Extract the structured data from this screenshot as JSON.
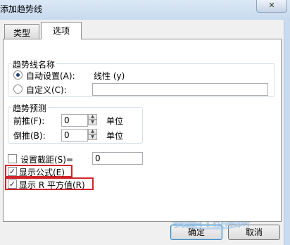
{
  "window": {
    "title": "添加趋势线",
    "close_label": "✕"
  },
  "tabs": [
    {
      "label": "类型"
    },
    {
      "label": "选项"
    }
  ],
  "name_group": {
    "legend": "趋势线名称",
    "auto_label": "自动设置(A):",
    "auto_value": "线性 (y)",
    "custom_label": "自定义(C):",
    "custom_value": ""
  },
  "forecast_group": {
    "legend": "趋势预测",
    "forward_label": "前推(F):",
    "forward_value": "0",
    "backward_label": "倒推(B):",
    "backward_value": "0",
    "unit": "单位"
  },
  "options": {
    "intercept_label": "设置截距(S)=",
    "intercept_value": "0",
    "intercept_checked": false,
    "show_equation_label": "显示公式(E)",
    "show_equation_checked": true,
    "show_r2_label": "显示 R 平方值(R)",
    "show_r2_checked": true,
    "check_glyph": "✓"
  },
  "buttons": {
    "ok": "确定",
    "cancel": "取消"
  },
  "watermark": {
    "text": "我爱IT技术网"
  },
  "colors": {
    "highlight": "#d2242b",
    "titlebar": "#c7daee"
  }
}
